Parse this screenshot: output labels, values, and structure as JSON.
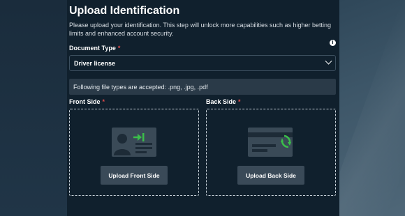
{
  "modal": {
    "title": "Upload Identification",
    "description": "Please upload your identification. This step will unlock more capabilities such as higher betting limits and enhanced account security."
  },
  "document_type": {
    "label": "Document Type",
    "required_marker": "*",
    "selected": "Driver license",
    "info_icon": "info-icon"
  },
  "accepted_types": "Following file types are accepted: .png, .jpg, .pdf",
  "front": {
    "label": "Front Side",
    "required_marker": "*",
    "button": "Upload Front Side"
  },
  "back": {
    "label": "Back Side",
    "required_marker": "*",
    "button": "Upload Back Side"
  },
  "colors": {
    "accent": "#3bbf4a",
    "required": "#e04a4a",
    "modal_bg": "#10202d"
  }
}
